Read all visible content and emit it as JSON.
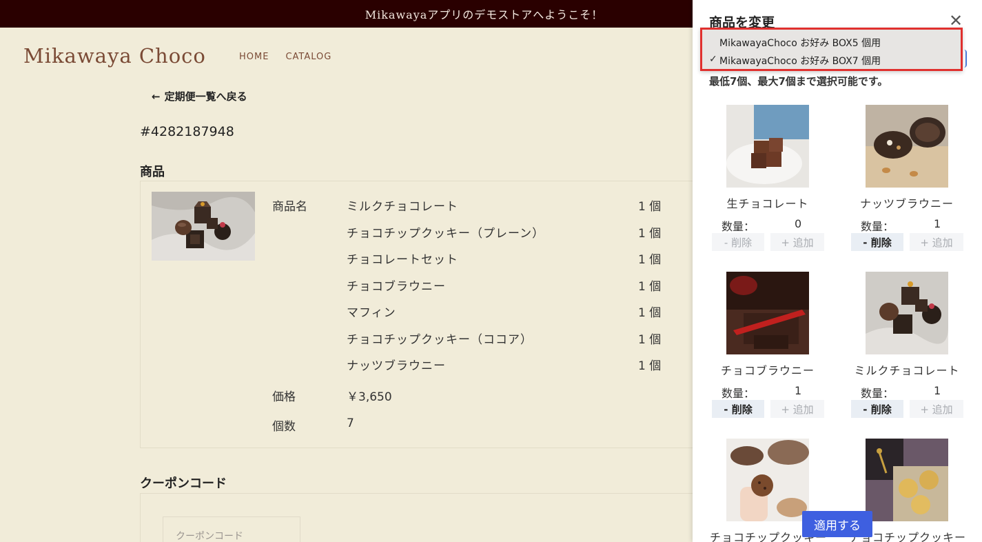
{
  "announcement": "Mikawayaアプリのデモストアへようこそ！",
  "header": {
    "logo": "Mikawaya Choco",
    "nav": [
      "HOME",
      "CATALOG"
    ]
  },
  "back_link": "定期便一覧へ戻る",
  "order_number": "#4282187948",
  "products_section": {
    "title": "商品",
    "name_label": "商品名",
    "items": [
      {
        "name": "ミルクチョコレート",
        "qty": "1 個"
      },
      {
        "name": "チョコチップクッキー（プレーン）",
        "qty": "1 個"
      },
      {
        "name": "チョコレートセット",
        "qty": "1 個"
      },
      {
        "name": "チョコブラウニー",
        "qty": "1 個"
      },
      {
        "name": "マフィン",
        "qty": "1 個"
      },
      {
        "name": "チョコチップクッキー（ココア）",
        "qty": "1 個"
      },
      {
        "name": "ナッツブラウニー",
        "qty": "1 個"
      }
    ],
    "price_label": "価格",
    "price_value": "￥3,650",
    "count_label": "個数",
    "count_value": "7"
  },
  "coupon": {
    "title": "クーポンコード",
    "placeholder": "クーポンコード"
  },
  "panel": {
    "title": "商品を変更",
    "hint": "最低7個、最大7個まで選択可能です。",
    "dropdown_options": [
      {
        "label": "MikawayaChoco お好み BOX5 個用",
        "selected": false
      },
      {
        "label": "MikawayaChoco お好み BOX7 個用",
        "selected": true
      }
    ],
    "check_mark": "✓",
    "qty_label": "数量：",
    "remove_label": "- 削除",
    "add_label": "+ 追加",
    "tiles": [
      {
        "name": "生チョコレート",
        "qty": "0",
        "remove_enabled": false
      },
      {
        "name": "ナッツブラウニー",
        "qty": "1",
        "remove_enabled": true
      },
      {
        "name": "チョコブラウニー",
        "qty": "1",
        "remove_enabled": true
      },
      {
        "name": "ミルクチョコレート",
        "qty": "1",
        "remove_enabled": true
      },
      {
        "name": "チョコチップクッキー",
        "qty": "",
        "remove_enabled": false
      },
      {
        "name": "チョコチップクッキー",
        "qty": "",
        "remove_enabled": false
      }
    ],
    "apply_label": "適用する"
  },
  "colors": {
    "background": "#f1ecd9",
    "announce_bg": "#2a0000",
    "brand": "#7a4a35",
    "apply": "#3e5fe0",
    "highlight": "#e0302e"
  }
}
